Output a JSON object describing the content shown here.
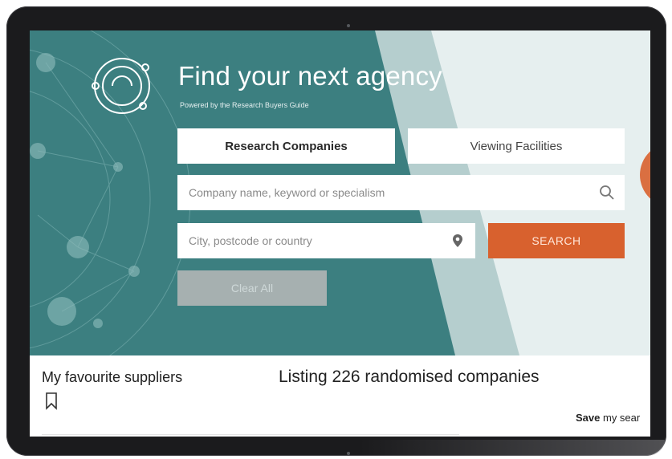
{
  "hero": {
    "title": "Find your next agency",
    "subtitle": "Powered by the Research Buyers Guide"
  },
  "tabs": [
    {
      "label": "Research Companies",
      "active": true
    },
    {
      "label": "Viewing Facilities",
      "active": false
    }
  ],
  "search": {
    "company_placeholder": "Company name, keyword or specialism",
    "company_icon": "search-icon",
    "location_placeholder": "City, postcode or country",
    "location_icon": "map-pin-icon",
    "search_label": "SEARCH",
    "clear_label": "Clear All"
  },
  "favourites": {
    "title": "My favourite suppliers",
    "icon": "bookmark-icon"
  },
  "listing": {
    "title": "Listing 226 randomised companies"
  },
  "save_search": {
    "bold": "Save",
    "rest": " my sear"
  },
  "colors": {
    "hero_teal": "#3c7f80",
    "search_orange": "#d8612e",
    "clear_grey": "#b9b9b9",
    "device_frame": "#1b1b1d"
  }
}
